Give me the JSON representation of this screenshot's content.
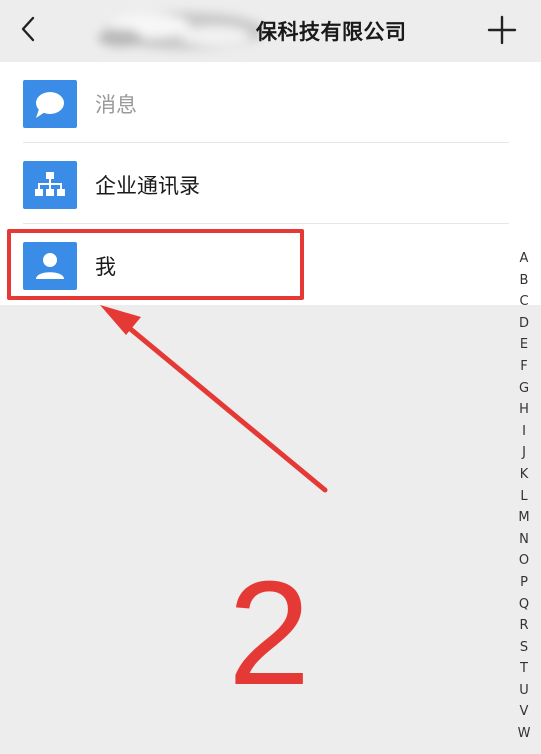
{
  "header": {
    "title_visible": "保科技有限公司",
    "back_icon": "chevron-left-icon",
    "add_icon": "plus-icon"
  },
  "list": {
    "items": [
      {
        "label": "消息",
        "icon": "chat-bubble-icon"
      },
      {
        "label": "企业通讯录",
        "icon": "org-chart-icon"
      },
      {
        "label": "我",
        "icon": "person-icon"
      }
    ]
  },
  "index_bar": {
    "letters": [
      "A",
      "B",
      "C",
      "D",
      "E",
      "F",
      "G",
      "H",
      "I",
      "J",
      "K",
      "L",
      "M",
      "N",
      "O",
      "P",
      "Q",
      "R",
      "S",
      "T",
      "U",
      "V",
      "W"
    ]
  },
  "annotation": {
    "step_number": "2",
    "color": "#e53935"
  },
  "colors": {
    "icon_background": "#3a8ce6",
    "page_background": "#ededed"
  }
}
